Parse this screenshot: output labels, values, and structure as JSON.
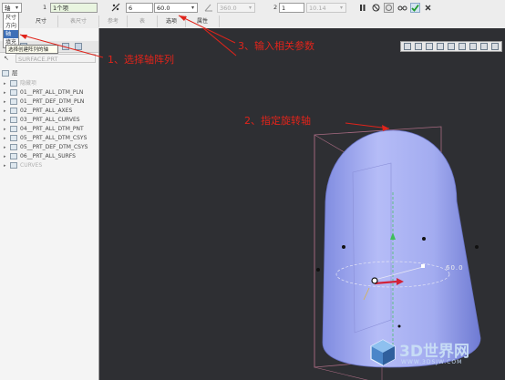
{
  "dashboard": {
    "type_label": "轴",
    "step1": "1",
    "count1": "1个项",
    "count2": "6",
    "angle": "60.0",
    "angle_disabled": "360.0",
    "step2": "2",
    "count3": "1",
    "value_disabled": "10.14",
    "tabs": [
      "尺寸",
      "表尺寸",
      "参考",
      "表",
      "选项",
      "属性"
    ]
  },
  "dropdown": {
    "options": [
      "尺寸",
      "方向",
      "轴",
      "填充"
    ],
    "selected": "轴",
    "tooltip": "选择创建阵列的轴"
  },
  "tree": {
    "toolbar_label": "层",
    "filter_placeholder": "SURFACE.PRT",
    "items": [
      {
        "label": "隐藏项",
        "disabled": true
      },
      {
        "label": "01__PRT_ALL_DTM_PLN",
        "disabled": false
      },
      {
        "label": "01__PRT_DEF_DTM_PLN",
        "disabled": false
      },
      {
        "label": "02__PRT_ALL_AXES",
        "disabled": false
      },
      {
        "label": "03__PRT_ALL_CURVES",
        "disabled": false
      },
      {
        "label": "04__PRT_ALL_DTM_PNT",
        "disabled": false
      },
      {
        "label": "05__PRT_ALL_DTM_CSYS",
        "disabled": false
      },
      {
        "label": "05__PRT_DEF_DTM_CSYS",
        "disabled": false
      },
      {
        "label": "06__PRT_ALL_SURFS",
        "disabled": false
      },
      {
        "label": "CURVES",
        "disabled": true
      }
    ]
  },
  "annotations": {
    "a1": "1、选择轴阵列",
    "a2": "2、指定旋转轴",
    "a3": "3、输入相关参数"
  },
  "model": {
    "angle_label": "60.0"
  },
  "watermark": {
    "text": "3D世界网",
    "url": "WWW.3DSJW.COM"
  },
  "colors": {
    "body_fill": "#a9b3f2",
    "accent_red": "#e0241b",
    "viewport_bg": "#2e2f33"
  }
}
